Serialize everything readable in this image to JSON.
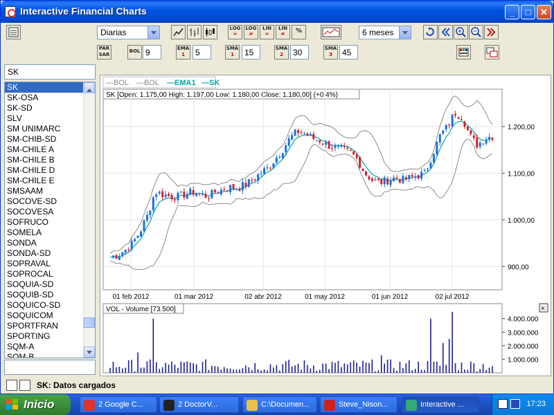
{
  "window": {
    "title": "Interactive Financial Charts"
  },
  "toolbar": {
    "period": "Diarias",
    "range": "6 meses",
    "buttons": {
      "log1": "LOG",
      "log2": "LOG",
      "lin1": "LIN",
      "lin2": "LIN",
      "pct": "%",
      "parsar": "PAR SAR",
      "bol": "BOL",
      "ema": "EMA",
      "sma1": "SMA",
      "sma2": "SMA",
      "sma3": "SMA"
    },
    "params": {
      "bol": "9",
      "ema": "5",
      "sma1": "15",
      "sma2": "30",
      "sma3": "45"
    }
  },
  "search": {
    "value": "SK"
  },
  "list": {
    "items": [
      "SK",
      "SK-OSA",
      "SK-SD",
      "SLV",
      "SM UNIMARC",
      "SM-CHIB-SD",
      "SM-CHILE A",
      "SM-CHILE B",
      "SM-CHILE D",
      "SM-CHILE E",
      "SMSAAM",
      "SOCOVE-SD",
      "SOCOVESA",
      "SOFRUCO",
      "SOMELA",
      "SONDA",
      "SONDA-SD",
      "SOPRAVAL",
      "SOPROCAL",
      "SOQUIA-SD",
      "SOQUIB-SD",
      "SOQUICO-SD",
      "SOQUICOM",
      "SPORTFRAN",
      "SPORTING",
      "SQM-A",
      "SQM-B"
    ],
    "selected": "SK"
  },
  "chart": {
    "legend": [
      "BOL",
      "BOL",
      "EMA1",
      "SK"
    ],
    "info": "SK [Open: 1.175,00  High: 1.197,00  Low: 1.180,00  Close: 1.180,00] (+0,4%)",
    "ylabels": [
      "1.200,00",
      "1.100,00",
      "1.000,00",
      "900,00"
    ],
    "xlabels": [
      "01 feb 2012",
      "01 mar 2012",
      "02 abr 2012",
      "01 may 2012",
      "01 jun 2012",
      "02 jul 2012"
    ],
    "volume_info": "VOL - Volume [73.500]",
    "volume_labels": [
      "4.000.000",
      "3.000.000",
      "2.000.000",
      "1.000.000"
    ],
    "colors": {
      "up": "#1a6fe0",
      "down": "#d8202a",
      "ema": "#00a7a7",
      "bol": "#8a8a8a",
      "volume": "#1a1a9a"
    }
  },
  "chart_data": {
    "type": "candlestick",
    "series": [
      {
        "name": "SK",
        "close_trend": [
          920,
          925,
          935,
          950,
          975,
          1010,
          1060,
          1055,
          1050,
          1050,
          1055,
          1060,
          1055,
          1050,
          1060,
          1065,
          1070,
          1068,
          1075,
          1085,
          1100,
          1110,
          1130,
          1150,
          1175,
          1190,
          1185,
          1175,
          1170,
          1160,
          1155,
          1150,
          1145,
          1130,
          1100,
          1085,
          1080,
          1085,
          1090,
          1085,
          1090,
          1095,
          1100,
          1140,
          1180,
          1200,
          1230,
          1220,
          1180,
          1160,
          1175,
          1180
        ]
      },
      {
        "name": "VOL",
        "peak": 4500000
      }
    ],
    "ylim": [
      850,
      1280
    ]
  },
  "status": {
    "text": "SK: Datos cargados"
  },
  "taskbar": {
    "start": "Inicio",
    "tasks": [
      "2 Google C...",
      "2 DoctorV...",
      "C:\\Documen...",
      "Steve_Nison...",
      "Interactive ..."
    ],
    "clock": "17:23"
  }
}
